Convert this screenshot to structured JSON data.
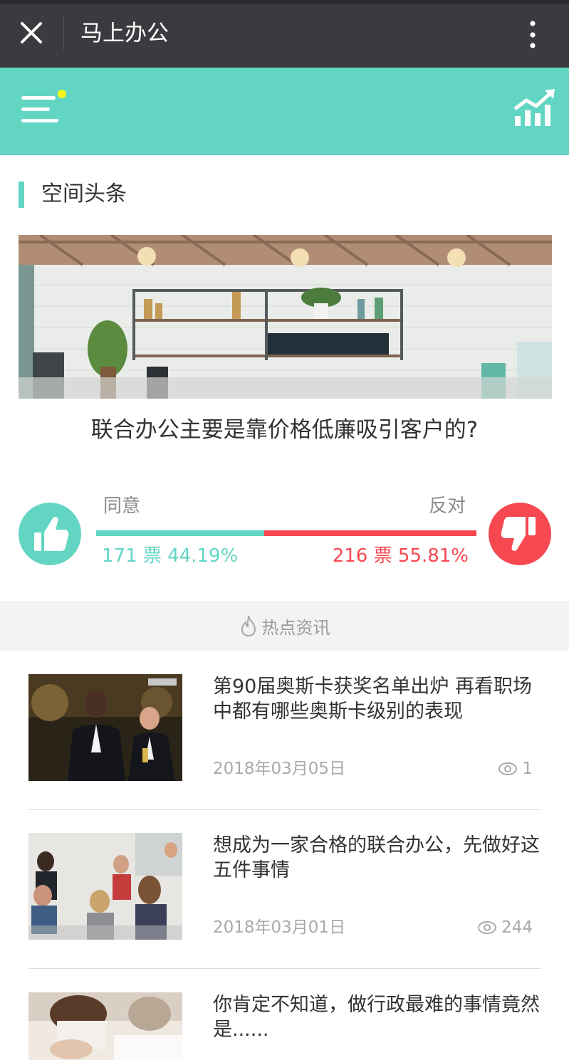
{
  "app": {
    "title": "马上办公"
  },
  "section": {
    "title": "空间头条"
  },
  "poll": {
    "question": "联合办公主要是靠价格低廉吸引客户的?",
    "agree_label": "同意",
    "oppose_label": "反对",
    "agree_text": "171 票 44.19%",
    "oppose_text": "216 票 55.81%",
    "agree_votes": 171,
    "oppose_votes": 216,
    "agree_fraction": 0.4419
  },
  "hot": {
    "label": "热点资讯"
  },
  "news": [
    {
      "title": "第90届奥斯卡获奖名单出炉 再看职场中都有哪些奥斯卡级别的表现",
      "date": "2018年03月05日",
      "views": "1"
    },
    {
      "title": "想成为一家合格的联合办公，先做好这五件事情",
      "date": "2018年03月01日",
      "views": "244"
    },
    {
      "title": "你肯定不知道，做行政最难的事情竟然是......",
      "date": "",
      "views": ""
    }
  ],
  "colors": {
    "accent": "#62d5c3",
    "danger": "#f64850",
    "topbar": "#3a3b3f"
  },
  "icons": {
    "close": "close-icon",
    "more": "more-vertical-icon",
    "menu": "menu-notify-icon",
    "stats": "trend-chart-icon",
    "agree": "thumbs-up-icon",
    "oppose": "thumbs-down-icon",
    "hot": "flame-icon",
    "views": "eye-icon"
  }
}
